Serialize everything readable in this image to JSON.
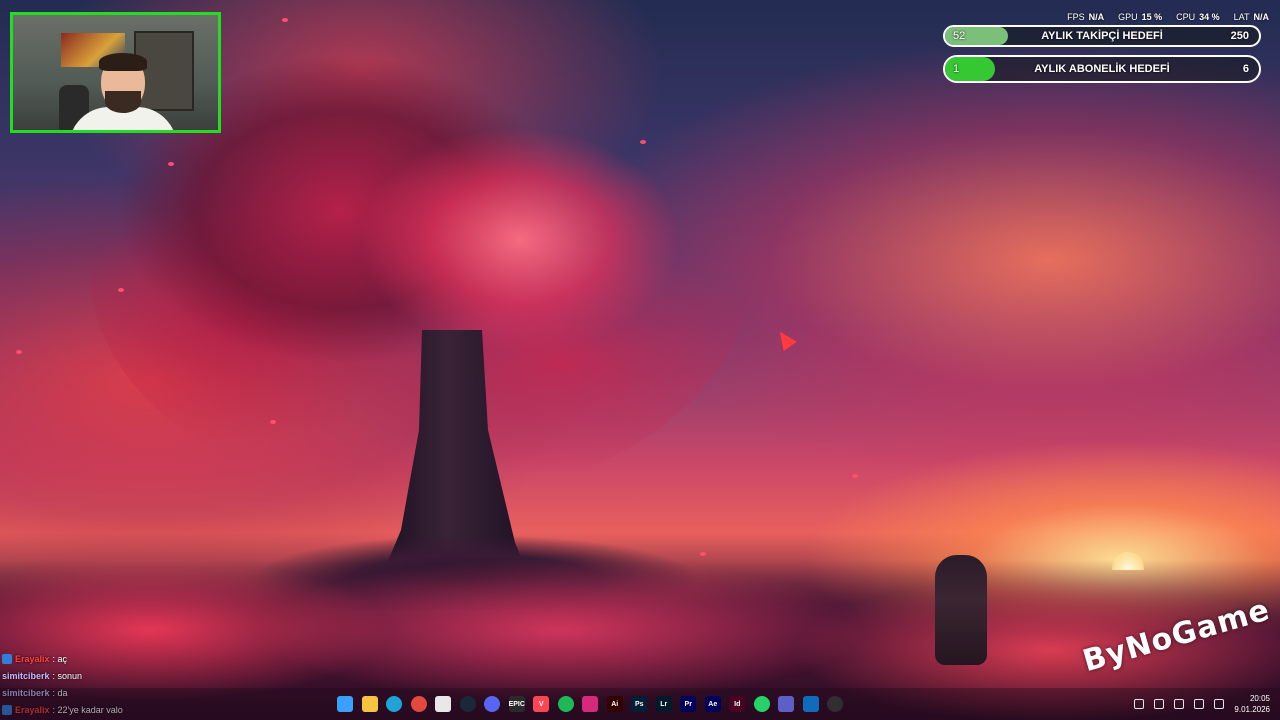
{
  "stats": {
    "fps_label": "FPS",
    "fps_value": "N/A",
    "gpu_label": "GPU",
    "gpu_value": "15 %",
    "cpu_label": "CPU",
    "cpu_value": "34 %",
    "lat_label": "LAT",
    "lat_value": "N/A"
  },
  "goals": [
    {
      "title": "AYLIK TAKİPÇİ HEDEFİ",
      "current": "52",
      "target": "250",
      "progress": 0.2,
      "color": "#7cbf78"
    },
    {
      "title": "AYLIK ABONELİK HEDEFİ",
      "current": "1",
      "target": "6",
      "progress": 0.16,
      "color": "#35c832"
    }
  ],
  "chat": [
    {
      "user": "Erayalix",
      "message": ": aç",
      "user_color": "#ff4040",
      "badge": true
    },
    {
      "user": "simitciberk",
      "message": ": sonun",
      "user_color": "#c9b8ff",
      "badge": false
    },
    {
      "user": "simitciberk",
      "message": ": da",
      "user_color": "#c9b8ff",
      "badge": false
    },
    {
      "user": "Erayalix",
      "message": ": 22'ye kadar valo",
      "user_color": "#ff4040",
      "badge": true
    }
  ],
  "watermark": {
    "text": "ByNoGame"
  },
  "taskbar": {
    "apps": [
      {
        "name": "windows-start-icon",
        "glyph": "",
        "color": "#3aa0ff"
      },
      {
        "name": "file-explorer-icon",
        "glyph": "",
        "color": "#f5c542"
      },
      {
        "name": "edge-icon",
        "glyph": "",
        "color": "#1fa3d8"
      },
      {
        "name": "chrome-icon",
        "glyph": "",
        "color": "#e5483f"
      },
      {
        "name": "microsoft-store-icon",
        "glyph": "",
        "color": "#e8e8e8"
      },
      {
        "name": "steam-icon",
        "glyph": "",
        "color": "#1b2838"
      },
      {
        "name": "discord-icon",
        "glyph": "",
        "color": "#5865f2"
      },
      {
        "name": "epic-games-icon",
        "glyph": "EPIC",
        "color": "#2a2a2a"
      },
      {
        "name": "valorant-icon",
        "glyph": "V",
        "color": "#fd4556"
      },
      {
        "name": "spotify-icon",
        "glyph": "",
        "color": "#1db954"
      },
      {
        "name": "instagram-icon",
        "glyph": "",
        "color": "#d6297a"
      },
      {
        "name": "illustrator-icon",
        "glyph": "Ai",
        "color": "#330000"
      },
      {
        "name": "photoshop-icon",
        "glyph": "Ps",
        "color": "#001e36"
      },
      {
        "name": "lightroom-icon",
        "glyph": "Lr",
        "color": "#001a2b"
      },
      {
        "name": "premiere-icon",
        "glyph": "Pr",
        "color": "#00005b"
      },
      {
        "name": "after-effects-icon",
        "glyph": "Ae",
        "color": "#00005b"
      },
      {
        "name": "indesign-icon",
        "glyph": "Id",
        "color": "#49021f"
      },
      {
        "name": "whatsapp-icon",
        "glyph": "",
        "color": "#25d366"
      },
      {
        "name": "teams-icon",
        "glyph": "",
        "color": "#5b5fc7"
      },
      {
        "name": "outlook-icon",
        "glyph": "",
        "color": "#0f6cbd"
      },
      {
        "name": "obs-icon",
        "glyph": "",
        "color": "#302e31"
      }
    ],
    "clock_time": "20:05",
    "clock_date": "9.01.2026"
  }
}
